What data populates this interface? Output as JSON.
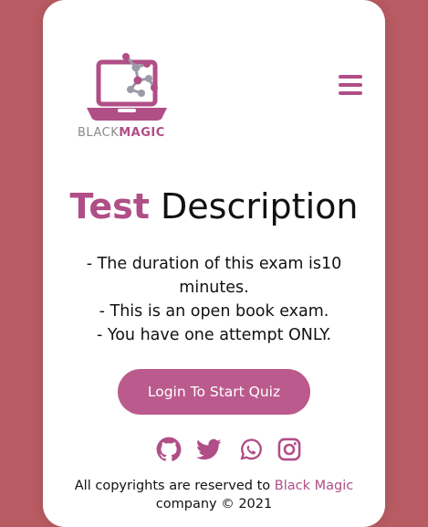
{
  "header": {
    "logo_text_black": "BLACK",
    "logo_text_magic": "MAGIC",
    "menu_icon": "hamburger-menu-icon"
  },
  "main": {
    "title_accent": "Test",
    "title_rest": " Description",
    "description_lines": [
      "- The duration of this exam is10",
      "minutes.",
      "- This is an open book exam.",
      "- You have one attempt ONLY."
    ],
    "start_button_label": "Login To Start Quiz"
  },
  "social": {
    "icons": [
      "github-icon",
      "twitter-icon",
      "whatsapp-icon",
      "instagram-icon"
    ]
  },
  "footer": {
    "text_before": "All copyrights are reserved to ",
    "brand": "Black Magic",
    "text_after": "company © 2021"
  },
  "colors": {
    "background": "#b85b62",
    "accent": "#b04e87",
    "button": "#bb5a8d",
    "card": "#ffffff"
  }
}
